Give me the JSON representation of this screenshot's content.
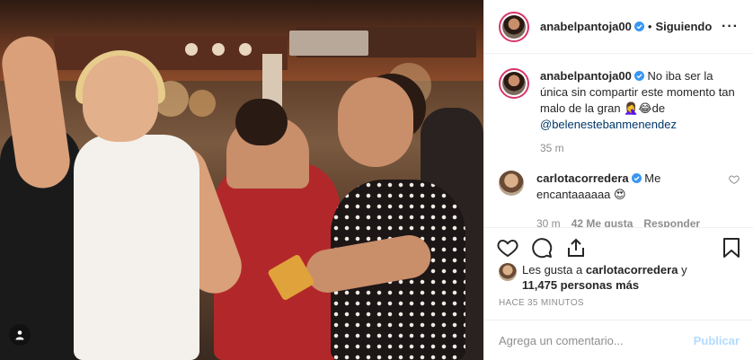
{
  "post": {
    "author": "anabelpantoja00",
    "follow_status": "Siguiendo",
    "more_icon": "more-horizontal-icon"
  },
  "caption": {
    "author": "anabelpantoja00",
    "text_before": "No iba ser la única sin compartir este momento tan malo de la gran ",
    "emoji": "🤦‍♀️😂",
    "text_after": "de",
    "mention": "@belenestebanmenendez",
    "time": "35 m"
  },
  "comment": {
    "author": "carlotacorredera",
    "text": "Me encantaaaaaa 😍",
    "time": "30 m",
    "likes": "42 Me gusta",
    "reply": "Responder"
  },
  "likes": {
    "prefix": "Les gusta a ",
    "user": "carlotacorredera",
    "middle": " y ",
    "count": "11,475 personas más"
  },
  "time_ago": "HACE 35 MINUTOS",
  "add_comment": {
    "placeholder": "Agrega un comentario...",
    "publish": "Publicar"
  },
  "icons": [
    "verified-icon",
    "heart-icon",
    "comment-icon",
    "share-icon",
    "save-icon",
    "user-tag-icon"
  ],
  "colors": {
    "story_ring": "#d8366a",
    "verified": "#3897f0",
    "mention": "#00376b",
    "publish_disabled": "#b3dbff"
  }
}
